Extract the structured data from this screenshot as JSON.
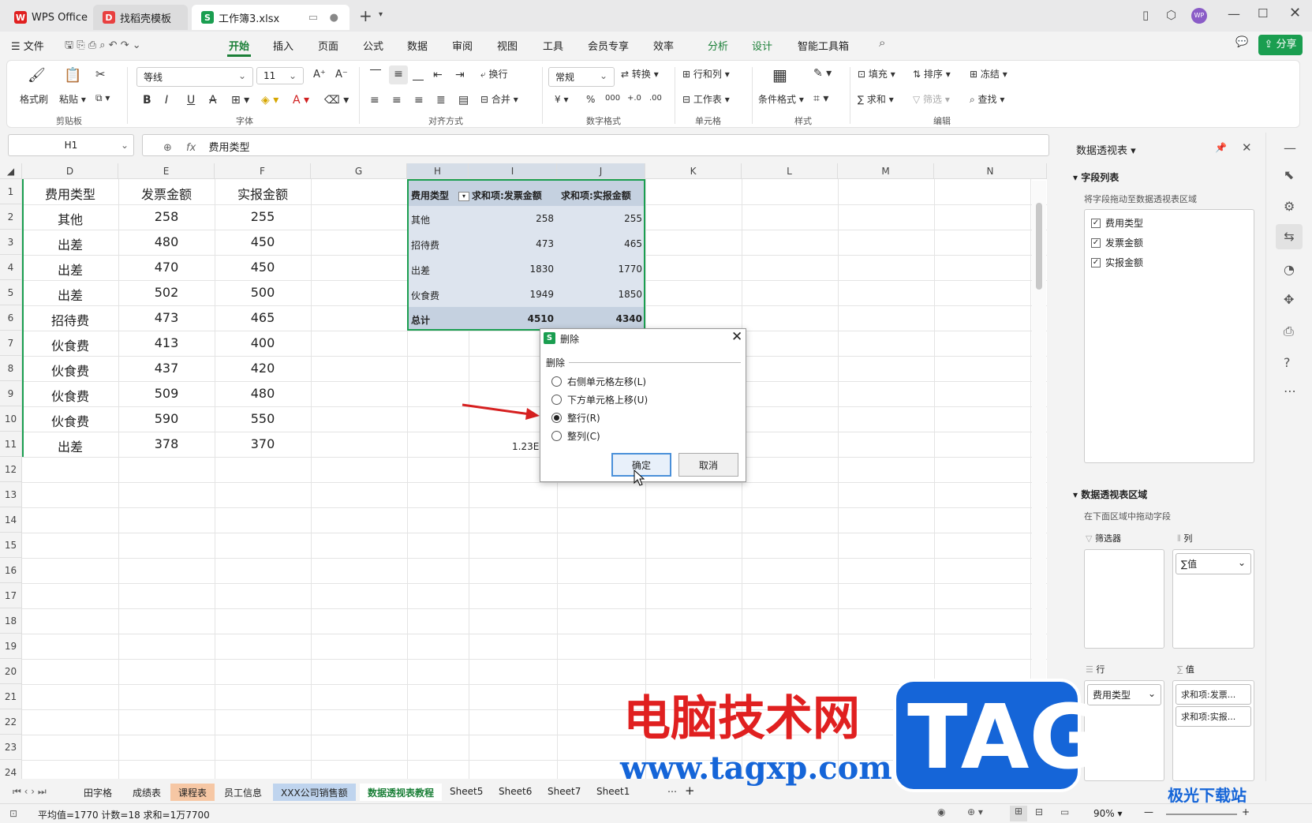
{
  "tabs": [
    {
      "label": "WPS Office",
      "logo": "W"
    },
    {
      "label": "找稻壳模板",
      "logo": "D"
    },
    {
      "label": "工作簿3.xlsx",
      "logo": "S"
    }
  ],
  "menu": {
    "file": "文件",
    "items": [
      "开始",
      "插入",
      "页面",
      "公式",
      "数据",
      "审阅",
      "视图",
      "工具",
      "会员专享",
      "效率",
      "分析",
      "设计",
      "智能工具箱"
    ],
    "active": "开始",
    "share": "分享"
  },
  "ribbon": {
    "format_painter": "格式刷",
    "paste": "粘贴",
    "clipboard_group": "剪贴板",
    "font_name": "等线",
    "font_size": "11",
    "font_group": "字体",
    "wrap": "换行",
    "merge": "合并",
    "align_group": "对齐方式",
    "number_format": "常规",
    "convert": "转换",
    "number_group": "数字格式",
    "row_col": "行和列",
    "worksheet": "工作表",
    "cell_group": "单元格",
    "cond_format": "条件格式",
    "style_group": "样式",
    "fill": "填充",
    "sort": "排序",
    "freeze": "冻结",
    "sum": "求和",
    "filter": "筛选",
    "find": "查找",
    "edit_group": "编辑"
  },
  "formula_bar": {
    "name_box": "H1",
    "content": "费用类型"
  },
  "columns": [
    "D",
    "E",
    "F",
    "G",
    "H",
    "I",
    "J",
    "K",
    "L",
    "M",
    "N"
  ],
  "rows": [
    "1",
    "2",
    "3",
    "4",
    "5",
    "6",
    "7",
    "8",
    "9",
    "10",
    "11",
    "12",
    "13",
    "14",
    "15",
    "16",
    "17",
    "18",
    "19",
    "20",
    "21",
    "22",
    "23",
    "24"
  ],
  "source_table": [
    [
      "费用类型",
      "发票金额",
      "实报金额"
    ],
    [
      "其他",
      "258",
      "255"
    ],
    [
      "出差",
      "480",
      "450"
    ],
    [
      "出差",
      "470",
      "450"
    ],
    [
      "出差",
      "502",
      "500"
    ],
    [
      "招待费",
      "473",
      "465"
    ],
    [
      "伙食费",
      "413",
      "400"
    ],
    [
      "伙食费",
      "437",
      "420"
    ],
    [
      "伙食费",
      "509",
      "480"
    ],
    [
      "伙食费",
      "590",
      "550"
    ],
    [
      "出差",
      "378",
      "370"
    ]
  ],
  "pivot": {
    "headers": [
      "费用类型",
      "求和项:发票金额",
      "求和项:实报金额"
    ],
    "rows": [
      [
        "其他",
        "258",
        "255"
      ],
      [
        "招待费",
        "473",
        "465"
      ],
      [
        "出差",
        "1830",
        "1770"
      ],
      [
        "伙食费",
        "1949",
        "1850"
      ]
    ],
    "total": [
      "总计",
      "4510",
      "4340"
    ]
  },
  "stray_cell": "1.23E+",
  "dialog": {
    "title": "删除",
    "section": "删除",
    "options": [
      "右侧单元格左移(L)",
      "下方单元格上移(U)",
      "整行(R)",
      "整列(C)"
    ],
    "selected_index": 2,
    "ok": "确定",
    "cancel": "取消"
  },
  "panel": {
    "title": "数据透视表",
    "field_list": "字段列表",
    "field_hint": "将字段拖动至数据透视表区域",
    "fields": [
      "费用类型",
      "发票金额",
      "实报金额"
    ],
    "area_title": "数据透视表区域",
    "area_hint": "在下面区域中拖动字段",
    "filter_label": "筛选器",
    "col_label": "列",
    "col_value": "∑值",
    "row_label": "行",
    "value_label": "值",
    "row_value": "费用类型",
    "values": [
      "求和项:发票...",
      "求和项:实报..."
    ]
  },
  "sheets": [
    "田字格",
    "成绩表",
    "课程表",
    "员工信息",
    "XXX公司销售额",
    "数据透视表教程",
    "Sheet5",
    "Sheet6",
    "Sheet7",
    "Sheet1"
  ],
  "active_sheet": "数据透视表教程",
  "status": {
    "stats": "平均值=1770  计数=18  求和=1万7700",
    "zoom": "90%"
  },
  "watermark": {
    "text": "电脑技术网",
    "tag": "TAG",
    "url": "www.tagxp.com",
    "brand": "极光下载站"
  },
  "colors": {
    "accent": "#1a7f37",
    "pivot_header": "#c5d1e0",
    "pivot_body": "#dde4ee",
    "watermark_red": "#e02020",
    "watermark_blue": "#1565d8"
  }
}
